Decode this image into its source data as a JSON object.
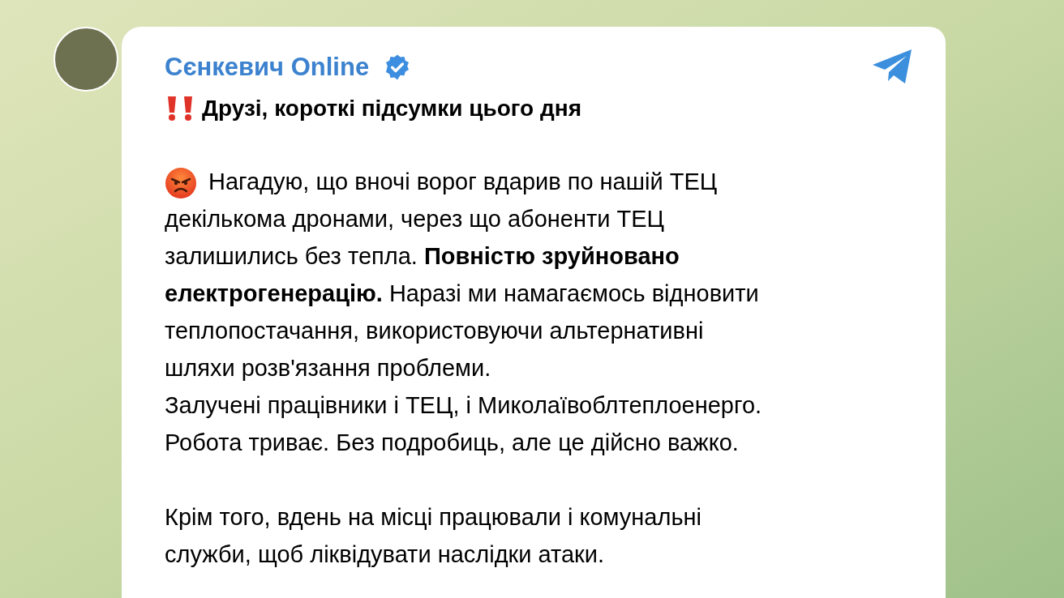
{
  "post": {
    "channel": "Сєнкевич Online",
    "verified": true,
    "title": "Друзі, короткі підсумки цього дня",
    "paragraphs": [
      {
        "kind": "emoji",
        "first_line": "Нагадую, що вночі ворог вдарив по нашій ТЕЦ",
        "text": "декількома дронами, через що абоненти ТЕЦ\nзалишились без тепла. **Повністю зруйновано**\n**електрогенерацію.** Наразі ми намагаємось відновити\nтеплопостачання, використовуючи альтернативні\nшляхи розв'язання проблеми.\nЗалучені працівники і ТЕЦ, і Миколаївоблтеплоенерго.\nРобота триває. Без подробиць, але це дійсно важко."
      },
      {
        "kind": "plain",
        "text": "Крім того, вдень на місці працювали і комунальні\nслужби, щоб ліквідувати наслідки атаки."
      }
    ]
  }
}
